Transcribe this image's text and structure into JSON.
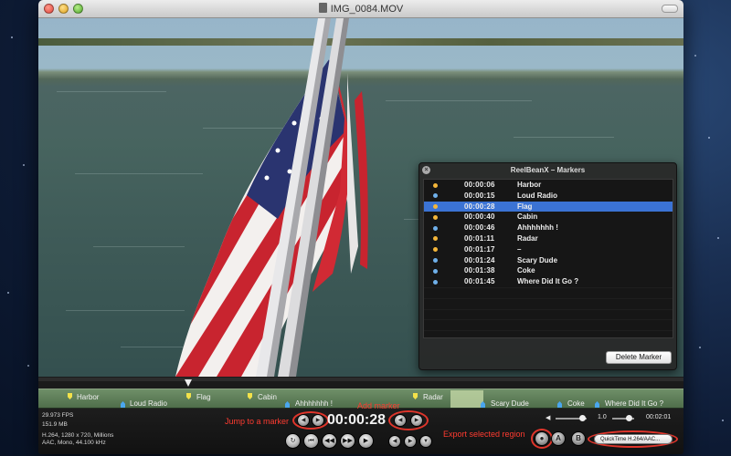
{
  "window": {
    "title": "IMG_0084.MOV",
    "file_icon": "movie-file-icon"
  },
  "markers_panel": {
    "title": "ReelBeanX – Markers",
    "rows": [
      {
        "time": "00:00:06",
        "name": "Harbor",
        "color": "#f4b63a",
        "selected": false
      },
      {
        "time": "00:00:15",
        "name": "Loud Radio",
        "color": "#6fb0ea",
        "selected": false
      },
      {
        "time": "00:00:28",
        "name": "Flag",
        "color": "#f4b63a",
        "selected": true
      },
      {
        "time": "00:00:40",
        "name": "Cabin",
        "color": "#f4b63a",
        "selected": false
      },
      {
        "time": "00:00:46",
        "name": "Ahhhhhhh !",
        "color": "#6fb0ea",
        "selected": false
      },
      {
        "time": "00:01:11",
        "name": "Radar",
        "color": "#f4b63a",
        "selected": false
      },
      {
        "time": "00:01:17",
        "name": "–",
        "color": "#f4b63a",
        "selected": false
      },
      {
        "time": "00:01:24",
        "name": "Scary Dude",
        "color": "#6fb0ea",
        "selected": false
      },
      {
        "time": "00:01:38",
        "name": "Coke",
        "color": "#6fb0ea",
        "selected": false
      },
      {
        "time": "00:01:45",
        "name": "Where Did It Go ?",
        "color": "#6fb0ea",
        "selected": false
      }
    ],
    "delete_label": "Delete Marker"
  },
  "timeline": {
    "markers": [
      {
        "label": "Harbor",
        "kind": "yellow"
      },
      {
        "label": "Loud Radio",
        "kind": "blue"
      },
      {
        "label": "Flag",
        "kind": "yellow"
      },
      {
        "label": "Cabin",
        "kind": "yellow"
      },
      {
        "label": "Ahhhhhhh !",
        "kind": "blue"
      },
      {
        "label": "Radar",
        "kind": "yellow"
      },
      {
        "label": "Scary Dude",
        "kind": "blue"
      },
      {
        "label": "Coke",
        "kind": "blue"
      },
      {
        "label": "Where Did It Go ?",
        "kind": "blue"
      }
    ]
  },
  "media_info": {
    "fps": "29.973 FPS",
    "size": "151.9 MB",
    "video": "H.264, 1280 x 720, Millions",
    "audio": "AAC, Mono, 44.100 kHz"
  },
  "annotations": {
    "jump": "Jump to a marker",
    "add": "Add marker",
    "export": "Export selected region"
  },
  "playback": {
    "timecode": "00:00:28",
    "rate": "1.0",
    "duration": "00:02:01",
    "format": "QuickTime H.264/AAC..."
  },
  "letter_buttons": {
    "a": "A",
    "b": "B"
  },
  "colors": {
    "selection": "#3b73d4",
    "annotation": "#ff3b30",
    "timeline": "#5e7e58"
  }
}
